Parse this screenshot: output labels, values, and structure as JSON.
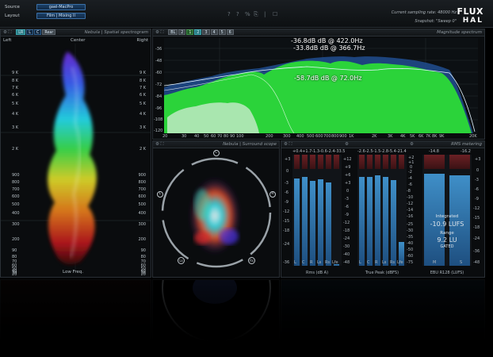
{
  "header": {
    "source_label": "Source",
    "source_value": "gael-MacPro",
    "layout_label": "Layout",
    "layout_value": "Film | Mixing II",
    "tools": [
      "?",
      "?",
      "%",
      "⎘",
      "|",
      "☐"
    ],
    "sampling_text": "Current sampling rate: 48000 Hz",
    "snapshot_text": "Snapshot: \"Sweep 0\"",
    "logo_top": "FLUX",
    "logo_bottom": "HAL"
  },
  "spatial": {
    "title": "Nebula | Spatial spectrogram",
    "left": "Left",
    "center": "Center",
    "right": "Right",
    "bottom_label": "Low Freq.",
    "freq_ticks": [
      "9 K",
      "8 K",
      "7 K",
      "6 K",
      "5 K",
      "4 K",
      "3 K",
      "2 K",
      "900",
      "800",
      "700",
      "600",
      "500",
      "400",
      "300",
      "200",
      "90",
      "80",
      "70",
      "60",
      "50",
      "40",
      "30",
      "20"
    ],
    "chips": [
      "LR",
      "L",
      "C",
      "Rear"
    ]
  },
  "spectrum": {
    "title": "Magnitude spectrum",
    "chips": [
      "BL",
      "2",
      "1",
      "2",
      "3",
      "4",
      "5",
      "6"
    ],
    "y_ticks": [
      "-36",
      "-48",
      "-60",
      "-72",
      "-84",
      "-96",
      "-108",
      "-120"
    ],
    "x_ticks": [
      "20",
      "30",
      "40",
      "50",
      "60",
      "70",
      "80",
      "90",
      "100",
      "200",
      "300",
      "400",
      "500",
      "600",
      "700",
      "800",
      "900",
      "1K",
      "2K",
      "3K",
      "4K",
      "5K",
      "6K",
      "7K",
      "8K",
      "9K",
      "20K"
    ],
    "peaks": [
      "-36.8dB dB @ 422.0Hz",
      "-33.8dB dB @ 366.7Hz",
      "-58.7dB dB @ 72.0Hz"
    ]
  },
  "surround": {
    "title": "Nebula | Surround scope",
    "speakers": [
      "C",
      "L",
      "R",
      "Ls",
      "Rs"
    ]
  },
  "rms": {
    "title": "RMS metering",
    "values_a": "+0.4+1.7-1.3-0.6-2.4-33.5",
    "values_b": "-2.6-2.5-1.5-2.8-5.4-21.4",
    "values_c_left": "-14.8",
    "values_c_right": "-16.2",
    "scale_a": [
      "+3",
      "0",
      "-3",
      "-6",
      "-9",
      "-12",
      "-15",
      "-18",
      "-24",
      "-36"
    ],
    "scale_b": [
      "+12",
      "+9",
      "+6",
      "+3",
      "0",
      "-3",
      "-6",
      "-9",
      "-12",
      "-18",
      "-24",
      "-30",
      "-40",
      "-48"
    ],
    "scale_c": [
      "+2",
      "+1",
      "0",
      "-1",
      "-2",
      "-3",
      "-4",
      "-5",
      "-6",
      "-7",
      "-8",
      "-9",
      "-10",
      "-11",
      "-12",
      "-13",
      "-14",
      "-15",
      "-16",
      "-17",
      "-18",
      "-19",
      "-20",
      "-25",
      "-30",
      "-35",
      "-40",
      "-45",
      "-50",
      "-55",
      "-60",
      "-65",
      "-70",
      "-75"
    ],
    "scale_d": [
      "+3",
      "0",
      "-3",
      "-6",
      "-9",
      "-12",
      "-15",
      "-18",
      "-24",
      "-36",
      "-48"
    ],
    "chan_a": [
      "L",
      "C",
      "R",
      "Ls",
      "Rs",
      "Lfe"
    ],
    "chan_b": [
      "L",
      "C",
      "R",
      "Ls",
      "Rs",
      "Lfe"
    ],
    "label_a": "Rms (dB A)",
    "label_b": "True Peak (dBFS)",
    "label_c": "EBU R128 (LUFS)",
    "integrated_label": "Integrated",
    "integrated_value": "-10.9 LUFS",
    "range_label": "Range",
    "range_value": "9.2 LU",
    "gated": "GATED",
    "m_label": "M",
    "s_label": "S"
  }
}
